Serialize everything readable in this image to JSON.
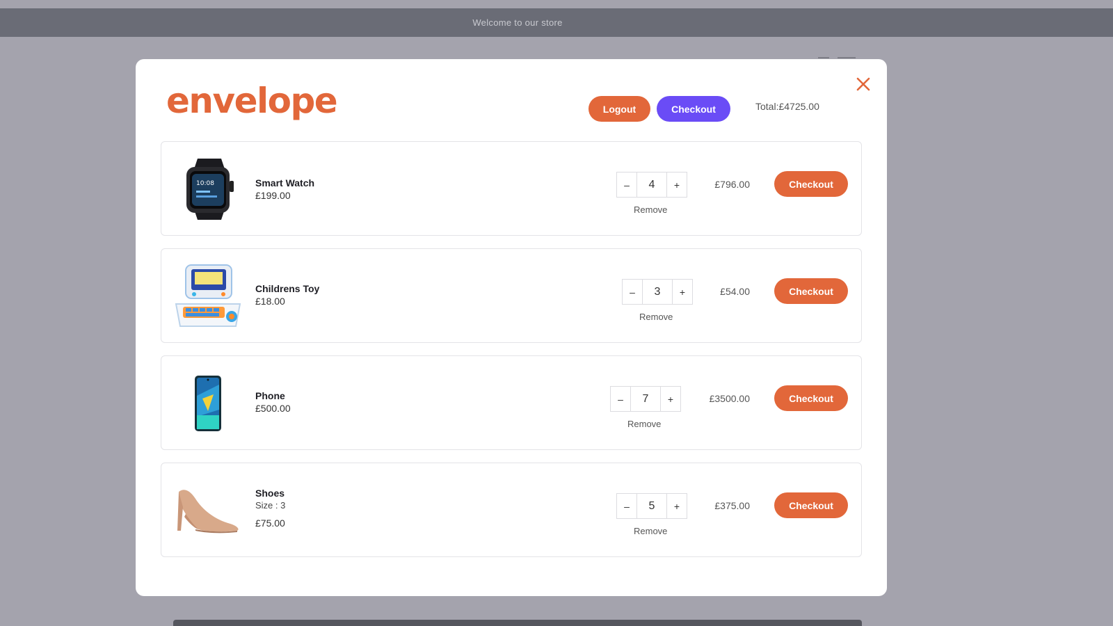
{
  "banner": {
    "text": "Welcome to our store"
  },
  "modal": {
    "logo": "envelope",
    "logout_label": "Logout",
    "checkout_label": "Checkout",
    "total_label": "Total:",
    "total_value": "£4725.00"
  },
  "cart": {
    "remove_label": "Remove",
    "checkout_label": "Checkout",
    "minus_label": "–",
    "plus_label": "+",
    "items": [
      {
        "name": "Smart Watch",
        "price": "£199.00",
        "size": "",
        "qty": "4",
        "line_total": "£796.00",
        "icon": "smart-watch-image"
      },
      {
        "name": "Childrens Toy",
        "price": "£18.00",
        "size": "",
        "qty": "3",
        "line_total": "£54.00",
        "icon": "kids-laptop-toy-image"
      },
      {
        "name": "Phone",
        "price": "£500.00",
        "size": "",
        "qty": "7",
        "line_total": "£3500.00",
        "icon": "phone-image"
      },
      {
        "name": "Shoes",
        "price": "£75.00",
        "size": "Size : 3",
        "qty": "5",
        "line_total": "£375.00",
        "icon": "high-heel-shoe-image"
      }
    ]
  },
  "colors": {
    "accent": "#e2673a",
    "checkout_purple": "#6a4cf6",
    "overlay": "#a4a3ad",
    "banner": "#6a6c76"
  }
}
